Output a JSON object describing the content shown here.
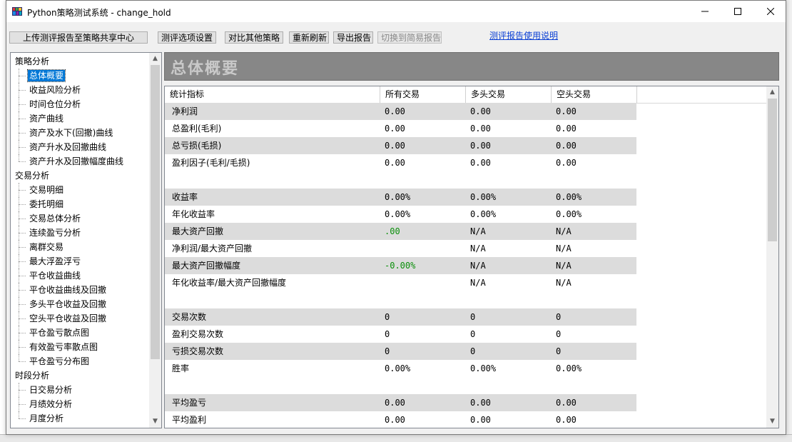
{
  "window": {
    "title": "Python策略测试系统 - change_hold",
    "minimize_glyph": "—",
    "maximize_glyph": "☐",
    "close_glyph": "✕"
  },
  "toolbar": {
    "upload_label": "上传测评报告至策略共享中心",
    "options_label": "测评选项设置",
    "compare_label": "对比其他策略",
    "refresh_label": "重新刷新",
    "export_label": "导出报告",
    "switch_label": "切换到简易报告",
    "help_link": "测评报告使用说明"
  },
  "tree": {
    "groups": [
      {
        "label": "策略分析",
        "items": [
          "总体概要",
          "收益风险分析",
          "时间仓位分析",
          "资产曲线",
          "资产及水下(回撤)曲线",
          "资产升水及回撤曲线",
          "资产升水及回撤幅度曲线"
        ]
      },
      {
        "label": "交易分析",
        "items": [
          "交易明细",
          "委托明细",
          "交易总体分析",
          "连续盈亏分析",
          "离群交易",
          "最大浮盈浮亏",
          "平仓收益曲线",
          "平仓收益曲线及回撤",
          "多头平仓收益及回撤",
          "空头平仓收益及回撤",
          "平仓盈亏散点图",
          "有效盈亏率散点图",
          "平仓盈亏分布图"
        ]
      },
      {
        "label": "时段分析",
        "items": [
          "日交易分析",
          "月绩效分析",
          "月度分析"
        ]
      }
    ],
    "selected": "总体概要",
    "scroll_up": "▲",
    "scroll_down": "▼"
  },
  "main": {
    "header_title": "总体概要",
    "columns": [
      "统计指标",
      "所有交易",
      "多头交易",
      "空头交易"
    ],
    "rows": [
      {
        "label": "净利润",
        "all": "0.00",
        "long": "0.00",
        "short": "0.00",
        "shade": true
      },
      {
        "label": "总盈利(毛利)",
        "all": "0.00",
        "long": "0.00",
        "short": "0.00",
        "shade": false
      },
      {
        "label": "总亏损(毛损)",
        "all": "0.00",
        "long": "0.00",
        "short": "0.00",
        "shade": true
      },
      {
        "label": "盈利因子(毛利/毛损)",
        "all": "0.00",
        "long": "0.00",
        "short": "0.00",
        "shade": false
      },
      {
        "label": "",
        "all": "",
        "long": "",
        "short": "",
        "shade": false
      },
      {
        "label": "收益率",
        "all": "0.00%",
        "long": "0.00%",
        "short": "0.00%",
        "shade": true
      },
      {
        "label": "年化收益率",
        "all": "0.00%",
        "long": "0.00%",
        "short": "0.00%",
        "shade": false
      },
      {
        "label": "最大资产回撤",
        "all": ".00",
        "long": "N/A",
        "short": "N/A",
        "shade": true,
        "all_green": true
      },
      {
        "label": "净利润/最大资产回撤",
        "all": "",
        "long": "N/A",
        "short": "N/A",
        "shade": false
      },
      {
        "label": "最大资产回撤幅度",
        "all": "-0.00%",
        "long": "N/A",
        "short": "N/A",
        "shade": true,
        "all_green": true
      },
      {
        "label": "年化收益率/最大资产回撤幅度",
        "all": "",
        "long": "N/A",
        "short": "N/A",
        "shade": false
      },
      {
        "label": "",
        "all": "",
        "long": "",
        "short": "",
        "shade": false
      },
      {
        "label": "交易次数",
        "all": "0",
        "long": "0",
        "short": "0",
        "shade": true
      },
      {
        "label": "盈利交易次数",
        "all": "0",
        "long": "0",
        "short": "0",
        "shade": false
      },
      {
        "label": "亏损交易次数",
        "all": "0",
        "long": "0",
        "short": "0",
        "shade": true
      },
      {
        "label": "胜率",
        "all": "0.00%",
        "long": "0.00%",
        "short": "0.00%",
        "shade": false
      },
      {
        "label": "",
        "all": "",
        "long": "",
        "short": "",
        "shade": false
      },
      {
        "label": "平均盈亏",
        "all": "0.00",
        "long": "0.00",
        "short": "0.00",
        "shade": true
      },
      {
        "label": "平均盈利",
        "all": "0.00",
        "long": "0.00",
        "short": "0.00",
        "shade": false
      }
    ],
    "scroll_up": "▲",
    "scroll_down": "▼"
  },
  "colors": {
    "selection": "#0078d7",
    "header_bar": "#878787",
    "row_shade": "#dcdcdc",
    "positive_green": "#0a8f0a",
    "link": "#0a3fd4"
  }
}
